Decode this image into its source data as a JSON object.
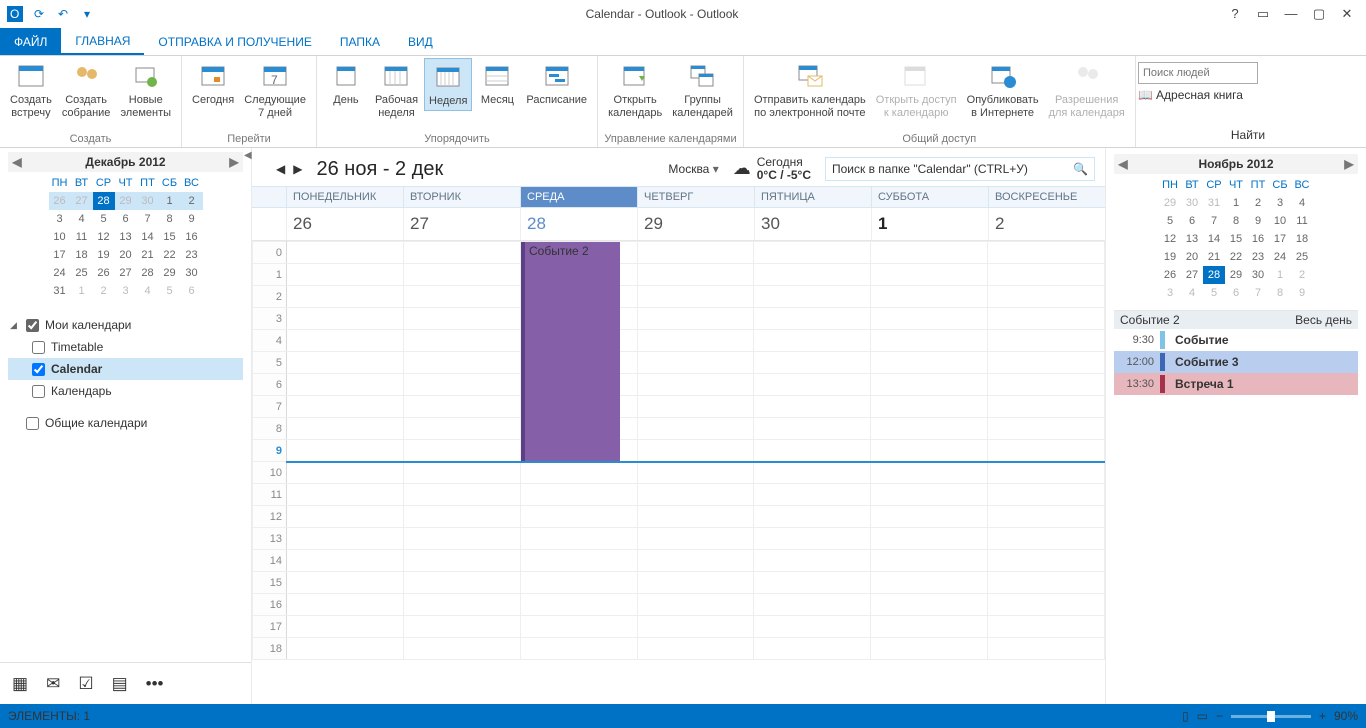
{
  "title": "Calendar - Outlook - Outlook",
  "tabs": {
    "file": "ФАЙЛ",
    "home": "ГЛАВНАЯ",
    "send": "ОТПРАВКА И ПОЛУЧЕНИЕ",
    "folder": "ПАПКА",
    "view": "ВИД"
  },
  "ribbon": {
    "new": {
      "appt": "Создать\nвстречу",
      "meeting": "Создать\nсобрание",
      "items": "Новые\nэлементы",
      "label": "Создать"
    },
    "goto": {
      "today": "Сегодня",
      "next7": "Следующие\n7 дней",
      "label": "Перейти"
    },
    "arrange": {
      "day": "День",
      "work": "Рабочая\nнеделя",
      "week": "Неделя",
      "month": "Месяц",
      "schedule": "Расписание",
      "label": "Упорядочить"
    },
    "manage": {
      "open": "Открыть\nкалендарь",
      "groups": "Группы\nкалендарей",
      "label": "Управление календарями"
    },
    "share": {
      "email": "Отправить календарь\nпо электронной почте",
      "access": "Открыть доступ\nк календарю",
      "publish": "Опубликовать\nв Интернете",
      "perms": "Разрешения\nдля календаря",
      "label": "Общий доступ"
    },
    "find": {
      "search": "Поиск людей",
      "addr": "Адресная книга",
      "label": "Найти"
    }
  },
  "leftCal": {
    "title": "Декабрь 2012",
    "dow": [
      "ПН",
      "ВТ",
      "СР",
      "ЧТ",
      "ПТ",
      "СБ",
      "ВС"
    ],
    "rows": [
      [
        {
          "d": 26,
          "o": 1
        },
        {
          "d": 27,
          "o": 1
        },
        {
          "d": 28,
          "o": 1,
          "t": 1
        },
        {
          "d": 29,
          "o": 1
        },
        {
          "d": 30,
          "o": 1
        },
        {
          "d": 1
        },
        {
          "d": 2
        }
      ],
      [
        {
          "d": 3
        },
        {
          "d": 4
        },
        {
          "d": 5
        },
        {
          "d": 6
        },
        {
          "d": 7
        },
        {
          "d": 8
        },
        {
          "d": 9
        }
      ],
      [
        {
          "d": 10
        },
        {
          "d": 11
        },
        {
          "d": 12
        },
        {
          "d": 13
        },
        {
          "d": 14
        },
        {
          "d": 15
        },
        {
          "d": 16
        }
      ],
      [
        {
          "d": 17
        },
        {
          "d": 18
        },
        {
          "d": 19
        },
        {
          "d": 20
        },
        {
          "d": 21
        },
        {
          "d": 22
        },
        {
          "d": 23
        }
      ],
      [
        {
          "d": 24
        },
        {
          "d": 25
        },
        {
          "d": 26
        },
        {
          "d": 27
        },
        {
          "d": 28
        },
        {
          "d": 29
        },
        {
          "d": 30
        }
      ],
      [
        {
          "d": 31
        },
        {
          "d": 1,
          "o": 1
        },
        {
          "d": 2,
          "o": 1
        },
        {
          "d": 3,
          "o": 1
        },
        {
          "d": 4,
          "o": 1
        },
        {
          "d": 5,
          "o": 1
        },
        {
          "d": 6,
          "o": 1
        }
      ]
    ]
  },
  "tree": {
    "myCals": "Мои календари",
    "items": [
      {
        "label": "Timetable",
        "checked": false
      },
      {
        "label": "Calendar",
        "checked": true,
        "sel": true
      },
      {
        "label": "Календарь",
        "checked": false
      }
    ],
    "shared": "Общие календари"
  },
  "center": {
    "range": "26 ноя - 2 дек",
    "location": "Москва",
    "weather": {
      "today": "Сегодня",
      "temp": "0°C / -5°C"
    },
    "searchPlaceholder": "Поиск в папке \"Calendar\" (CTRL+У)",
    "days": [
      "ПОНЕДЕЛЬНИК",
      "ВТОРНИК",
      "СРЕДА",
      "ЧЕТВЕРГ",
      "ПЯТНИЦА",
      "СУББОТА",
      "ВОСКРЕСЕНЬЕ"
    ],
    "dates": [
      "26",
      "27",
      "28",
      "29",
      "30",
      "1",
      "2"
    ],
    "todayIdx": 2,
    "boldIdx": 5,
    "hours": [
      0,
      1,
      2,
      3,
      4,
      5,
      6,
      7,
      8,
      9,
      10,
      11,
      12,
      13,
      14,
      15,
      16,
      17,
      18
    ],
    "currentHour": 9,
    "event": {
      "title": "Событие 2"
    }
  },
  "rightCal": {
    "title": "Ноябрь 2012",
    "dow": [
      "ПН",
      "ВТ",
      "СР",
      "ЧТ",
      "ПТ",
      "СБ",
      "ВС"
    ],
    "rows": [
      [
        {
          "d": 29,
          "o": 1
        },
        {
          "d": 30,
          "o": 1
        },
        {
          "d": 31,
          "o": 1
        },
        {
          "d": 1
        },
        {
          "d": 2
        },
        {
          "d": 3
        },
        {
          "d": 4
        }
      ],
      [
        {
          "d": 5
        },
        {
          "d": 6
        },
        {
          "d": 7
        },
        {
          "d": 8
        },
        {
          "d": 9
        },
        {
          "d": 10
        },
        {
          "d": 11
        }
      ],
      [
        {
          "d": 12
        },
        {
          "d": 13
        },
        {
          "d": 14
        },
        {
          "d": 15
        },
        {
          "d": 16
        },
        {
          "d": 17
        },
        {
          "d": 18
        }
      ],
      [
        {
          "d": 19
        },
        {
          "d": 20
        },
        {
          "d": 21
        },
        {
          "d": 22
        },
        {
          "d": 23
        },
        {
          "d": 24
        },
        {
          "d": 25
        }
      ],
      [
        {
          "d": 26
        },
        {
          "d": 27
        },
        {
          "d": 28,
          "t": 1
        },
        {
          "d": 29
        },
        {
          "d": 30
        },
        {
          "d": 1,
          "o": 1
        },
        {
          "d": 2,
          "o": 1
        }
      ],
      [
        {
          "d": 3,
          "o": 1
        },
        {
          "d": 4,
          "o": 1
        },
        {
          "d": 5,
          "o": 1
        },
        {
          "d": 6,
          "o": 1
        },
        {
          "d": 7,
          "o": 1
        },
        {
          "d": 8,
          "o": 1
        },
        {
          "d": 9,
          "o": 1
        }
      ]
    ]
  },
  "agenda": {
    "allday": {
      "title": "Событие 2",
      "label": "Весь день"
    },
    "rows": [
      {
        "time": "9:30",
        "title": "Событие"
      },
      {
        "time": "12:00",
        "title": "Событие 3"
      },
      {
        "time": "13:30",
        "title": "Встреча 1"
      }
    ]
  },
  "status": {
    "items": "ЭЛЕМЕНТЫ: 1",
    "zoom": "90%"
  }
}
